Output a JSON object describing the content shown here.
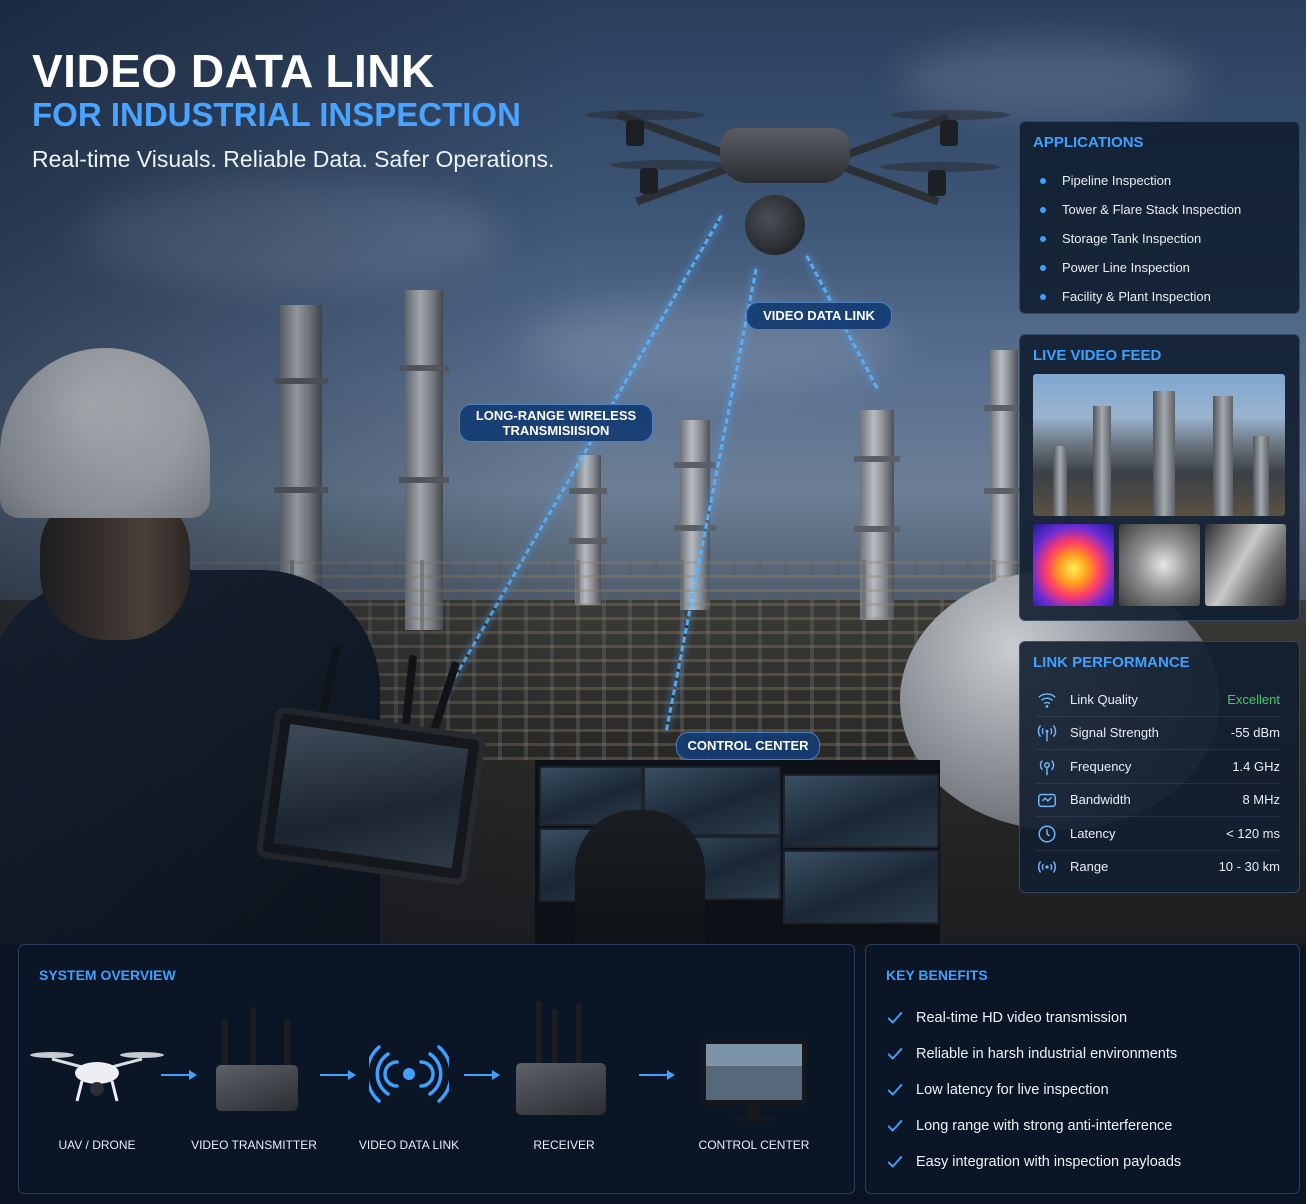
{
  "header": {
    "title": "VIDEO DATA LINK",
    "subtitle": "FOR INDUSTRIAL INSPECTION",
    "tagline": "Real-time Visuals. Reliable Data. Safer Operations."
  },
  "callouts": {
    "long_range": "LONG-RANGE WIRELESS TRANSMISIISION",
    "video_link": "VIDEO DATA LINK",
    "control_center": "CONTROL CENTER"
  },
  "applications": {
    "title": "APPLICATIONS",
    "items": [
      "Pipeline Inspection",
      "Tower & Flare Stack Inspection",
      "Storage Tank Inspection",
      "Power Line Inspection",
      "Facility & Plant Inspection"
    ]
  },
  "live_feed": {
    "title": "LIVE VIDEO FEED"
  },
  "link_performance": {
    "title": "LINK PERFORMANCE",
    "rows": [
      {
        "icon": "wifi-icon",
        "label": "Link Quality",
        "value": "Excellent"
      },
      {
        "icon": "antenna-icon",
        "label": "Signal Strength",
        "value": "-55 dBm"
      },
      {
        "icon": "broadcast-icon",
        "label": "Frequency",
        "value": "1.4 GHz"
      },
      {
        "icon": "bandwidth-icon",
        "label": "Bandwidth",
        "value": "8 MHz"
      },
      {
        "icon": "latency-icon",
        "label": "Latency",
        "value": "< 120 ms"
      },
      {
        "icon": "range-icon",
        "label": "Range",
        "value": "10 - 30 km"
      }
    ],
    "good_color": "#3fd064"
  },
  "system_overview": {
    "title": "SYSTEM OVERVIEW",
    "steps": [
      "UAV / DRONE",
      "VIDEO TRANSMITTER",
      "VIDEO DATA LINK",
      "RECEIVER",
      "CONTROL CENTER"
    ]
  },
  "key_benefits": {
    "title": "KEY BENEFITS",
    "items": [
      "Real-time HD video transmission",
      "Reliable in harsh industrial environments",
      "Low latency for live inspection",
      "Long range with strong anti-interference",
      "Easy integration with inspection payloads"
    ]
  },
  "colors": {
    "accent": "#3ea0ff",
    "title": "#ffffff",
    "subtitle": "#4aa3ff"
  }
}
